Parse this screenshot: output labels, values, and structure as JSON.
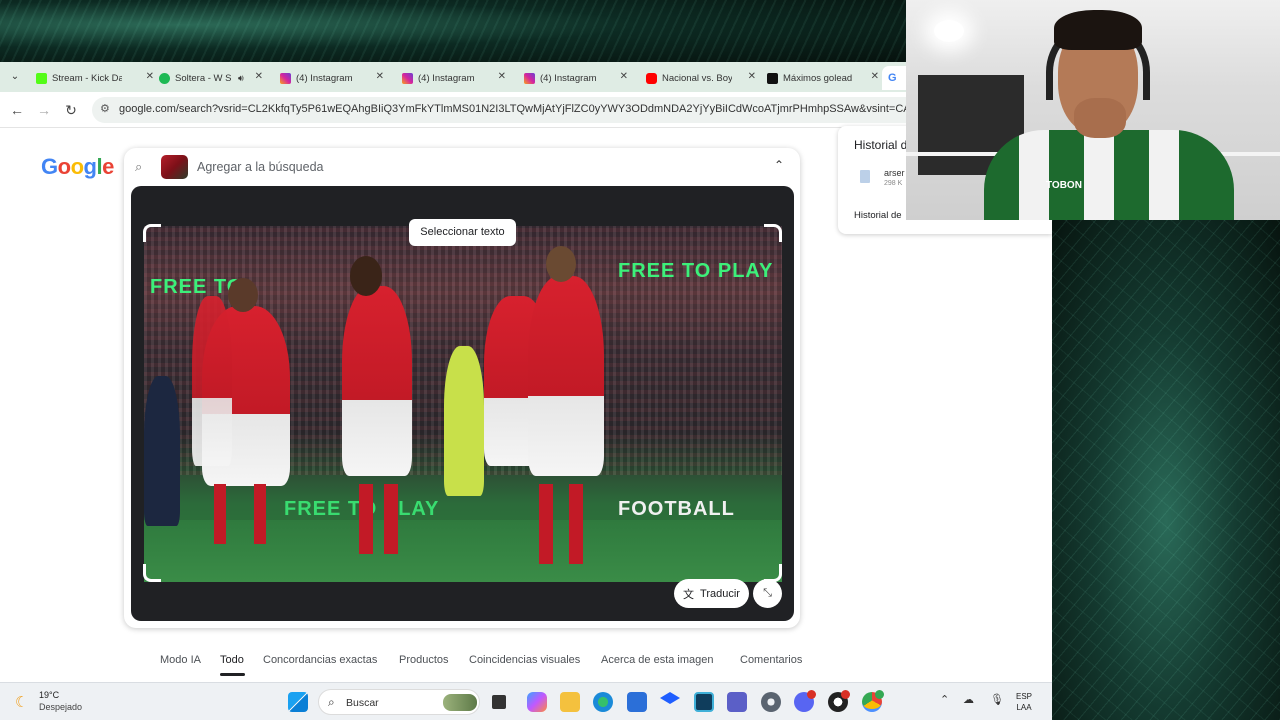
{
  "browser": {
    "tabs": [
      {
        "title": "Stream - Kick Da",
        "icon": "kick-icon",
        "color": "#53fc18"
      },
      {
        "title": "Soltera - W S",
        "icon": "spotify-icon",
        "color": "#1db954"
      },
      {
        "title": "(4) Instagram",
        "icon": "instagram-icon",
        "color": "#d6249f"
      },
      {
        "title": "(4) Instagram",
        "icon": "instagram-icon",
        "color": "#d6249f"
      },
      {
        "title": "(4) Instagram",
        "icon": "instagram-icon",
        "color": "#d6249f"
      },
      {
        "title": "Nacional vs. Boy",
        "icon": "youtube-icon",
        "color": "#ff0000"
      },
      {
        "title": "Máximos golead",
        "icon": "x-icon",
        "color": "#111111"
      },
      {
        "title": "G",
        "icon": "google-icon",
        "color": "#4285f4"
      }
    ],
    "url": "google.com/search?vsrid=CL2KkfqTy5P61wEQAhgBIiQ3YmFkYTlmMS01N2I3LTQwMjAtYjFlZC0yYWY3ODdmNDA2YjYyBiICdWcoATjmrPHmhpSSAw&vsint=CAIqDAoCCA"
  },
  "google": {
    "logo": "Google",
    "search_placeholder": "Agregar a la búsqueda",
    "select_text": "Seleccionar texto",
    "translate": "Traducir",
    "photo_boards": [
      "FREE TO PLAY",
      "FREE TO",
      "FREE TO PLAY",
      "FOOTBALL"
    ],
    "tabs": [
      "Modo IA",
      "Todo",
      "Concordancias exactas",
      "Productos",
      "Coincidencias visuales",
      "Acerca de esta imagen",
      "Comentarios"
    ],
    "active_tab": "Todo"
  },
  "history": {
    "title": "Historial d",
    "file_name": "arser",
    "file_size": "298 K",
    "footer": "Historial de"
  },
  "webcam": {
    "shirt_text": "TOBON"
  },
  "taskbar": {
    "temp": "19°C",
    "condition": "Despejado",
    "search_label": "Buscar",
    "lang_1": "ESP",
    "lang_2": "LAA"
  }
}
